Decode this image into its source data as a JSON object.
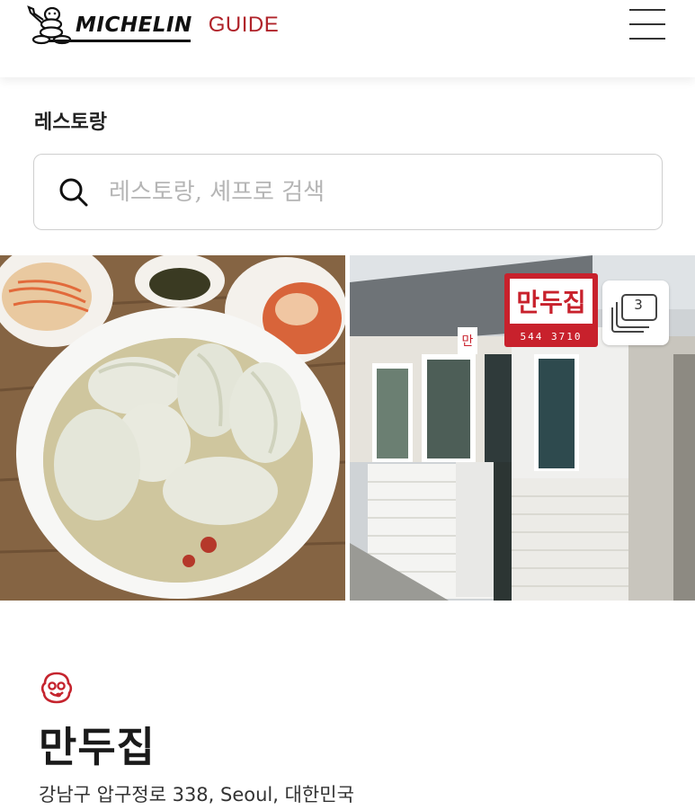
{
  "header": {
    "brand": "MICHELIN",
    "brand_suffix": "GUIDE",
    "brand_color": "#b0232a",
    "logo_icon": "bibendum-logo-icon",
    "menu_icon": "hamburger-menu-icon"
  },
  "section": {
    "title": "레스토랑"
  },
  "search": {
    "icon": "search-icon",
    "placeholder": "레스토랑, 셰프로 검색",
    "value": ""
  },
  "gallery": {
    "photos": [
      {
        "subject": "mandu-soup-photo"
      },
      {
        "subject": "restaurant-storefront-photo"
      }
    ],
    "sign_text": "만두집",
    "sign_phone": "544 3710",
    "door_sign": "만",
    "count": "3",
    "count_icon": "photo-stack-icon"
  },
  "restaurant": {
    "award_icon": "bib-gourmand-icon",
    "name": "만두집",
    "address": "강남구 압구정로 338, Seoul, 대한민국"
  }
}
